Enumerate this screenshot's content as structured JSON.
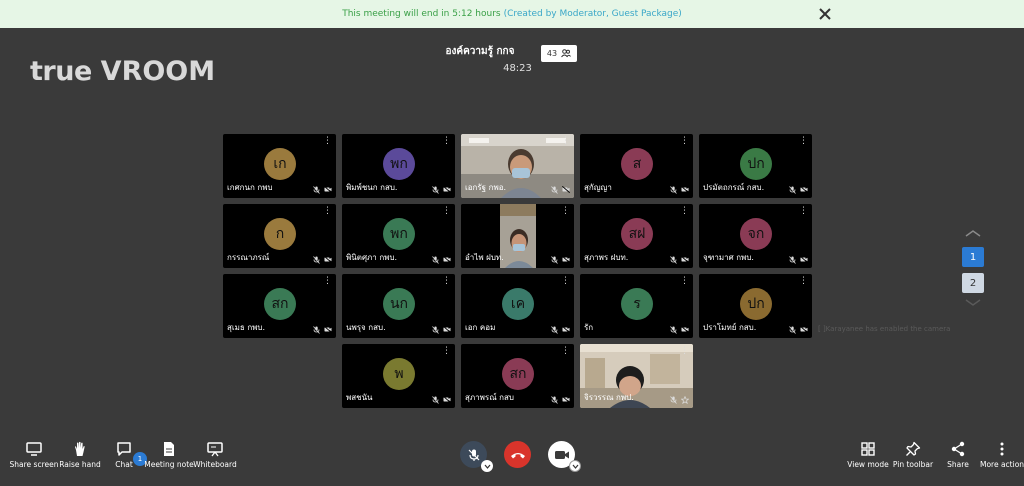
{
  "banner": {
    "message": "This meeting will end in 5:12 hours",
    "link": "(Created by Moderator, Guest Package)"
  },
  "logo": {
    "part1": "true",
    "part2": "VROOM"
  },
  "meeting": {
    "title": "องค์ความรู้ กกจ",
    "elapsed": "48:23",
    "participants": "43"
  },
  "tiles": [
    {
      "name": "เกศกนก กพบ",
      "initials": "เก",
      "color": "#9a7a3d",
      "video": false
    },
    {
      "name": "พิมพ์ชนก กสบ.",
      "initials": "พก",
      "color": "#5b4a9a",
      "video": false
    },
    {
      "name": "เอกรัฐ กพอ.",
      "initials": "",
      "color": "",
      "video": true
    },
    {
      "name": "สุกัญญา",
      "initials": "ส",
      "color": "#8a3b55",
      "video": false
    },
    {
      "name": "ปรมัตถกรณ์ กสบ.",
      "initials": "ปก",
      "color": "#3a7a45",
      "video": false
    },
    {
      "name": "กรรณาภรณ์",
      "initials": "ก",
      "color": "#9a7a3d",
      "video": false
    },
    {
      "name": "พินิตศุภา กพบ.",
      "initials": "พก",
      "color": "#3a7a55",
      "video": false
    },
    {
      "name": "อำไพ ฝบท.",
      "initials": "",
      "color": "",
      "video": true
    },
    {
      "name": "สุภาพร ฝบท.",
      "initials": "สฝ",
      "color": "#8a3b55",
      "video": false
    },
    {
      "name": "จุฑามาศ กพบ.",
      "initials": "จก",
      "color": "#8a3b55",
      "video": false
    },
    {
      "name": "สุเมธ กพบ.",
      "initials": "สก",
      "color": "#3a7a55",
      "video": false
    },
    {
      "name": "นพรุจ กสบ.",
      "initials": "นก",
      "color": "#3a7a55",
      "video": false
    },
    {
      "name": "เอก คอม",
      "initials": "เค",
      "color": "#3a7a6a",
      "video": false
    },
    {
      "name": "รัก",
      "initials": "ร",
      "color": "#3a7a55",
      "video": false
    },
    {
      "name": "ปราโมทย์ กสบ.",
      "initials": "ปก",
      "color": "#8a6a30",
      "video": false
    },
    {
      "name": "พสชนัน",
      "initials": "พ",
      "color": "#7a7a30",
      "video": false
    },
    {
      "name": "สุภาพรณ์ กสบ",
      "initials": "สก",
      "color": "#8a3b55",
      "video": false
    },
    {
      "name": "จิรวรรณ กพป.",
      "initials": "",
      "color": "",
      "video": true
    }
  ],
  "pager": {
    "page1": "1",
    "page2": "2"
  },
  "ghost_text": "[ ]Karayanee has enabled the camera",
  "toolbar": {
    "share_screen": "Share screen",
    "raise_hand": "Raise hand",
    "chat": "Chat",
    "chat_count": "1",
    "meeting_note": "Meeting note",
    "whiteboard": "Whiteboard",
    "view_mode": "View mode",
    "pin_toolbar": "Pin toolbar",
    "share": "Share",
    "more_action": "More action"
  },
  "colors": {
    "banner_bg": "#e6f6e6",
    "banner_text": "#3aa047",
    "accent": "#2b7bd4",
    "end_call": "#d9342b",
    "stage_bg": "#3a3a3a"
  }
}
